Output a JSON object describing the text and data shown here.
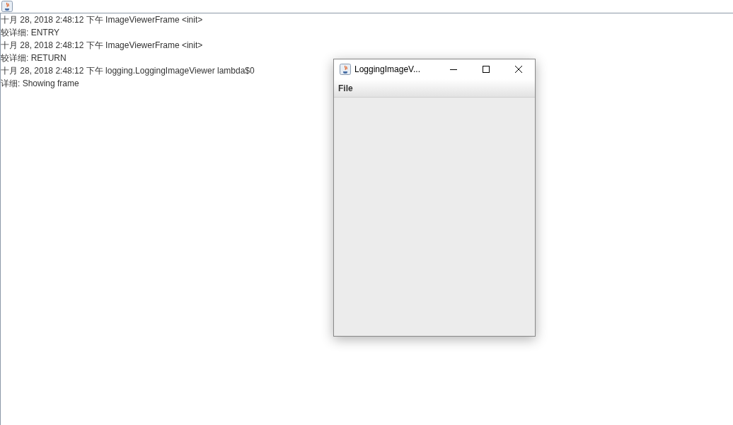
{
  "log_lines": [
    "十月 28, 2018 2:48:12 下午 ImageViewerFrame <init>",
    "较详细: ENTRY",
    "十月 28, 2018 2:48:12 下午 ImageViewerFrame <init>",
    "较详细: RETURN",
    "十月 28, 2018 2:48:12 下午 logging.LoggingImageViewer lambda$0",
    "详细: Showing frame"
  ],
  "window": {
    "title": "LoggingImageV...",
    "menu": [
      "File"
    ]
  }
}
